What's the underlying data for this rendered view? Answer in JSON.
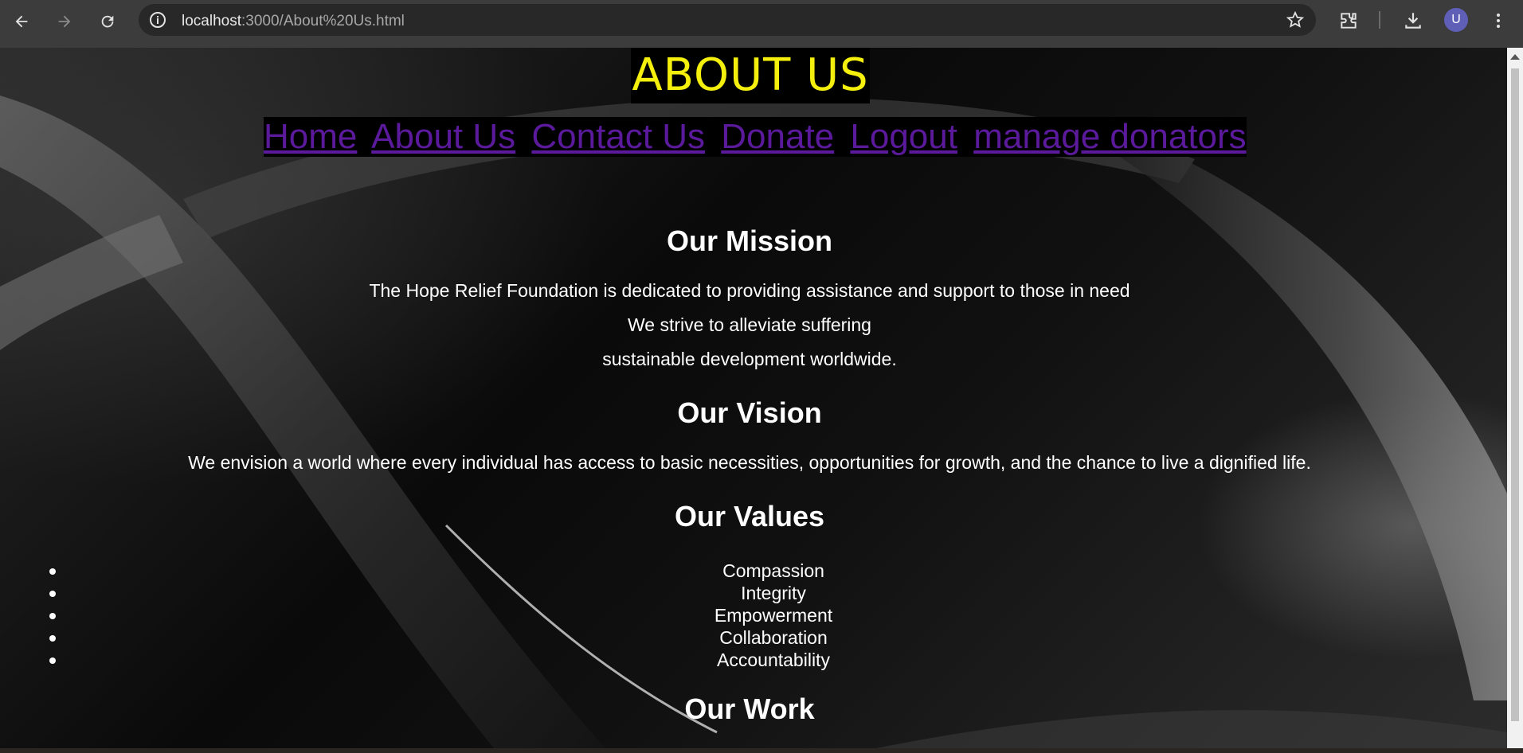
{
  "browser": {
    "url_host": "localhost",
    "url_rest": ":3000/About%20Us.html",
    "avatar_letter": "U",
    "icons": [
      "back-arrow-icon",
      "forward-arrow-icon",
      "reload-icon",
      "info-icon",
      "star-icon",
      "extensions-icon",
      "download-icon",
      "more-vert-icon"
    ]
  },
  "page": {
    "title": "ABOUT US",
    "nav": [
      "Home",
      "About Us",
      "Contact Us",
      "Donate",
      "Logout",
      "manage donators"
    ],
    "mission": {
      "heading": "Our Mission",
      "lines": [
        "The Hope Relief Foundation is dedicated to providing assistance and support to those in need",
        "We strive to alleviate suffering",
        "sustainable development worldwide."
      ]
    },
    "vision": {
      "heading": "Our Vision",
      "text": "We envision a world where every individual has access to basic necessities, opportunities for growth, and the chance to live a dignified life."
    },
    "values": {
      "heading": "Our Values",
      "items": [
        "Compassion",
        "Integrity",
        "Empowerment",
        "Collaboration",
        "Accountability"
      ]
    },
    "work": {
      "heading": "Our Work"
    }
  },
  "colors": {
    "title_text": "#f4ef0c",
    "nav_link": "#5a1a9b",
    "body_text": "#ffffff",
    "chrome_bg": "#3c3c3c"
  }
}
